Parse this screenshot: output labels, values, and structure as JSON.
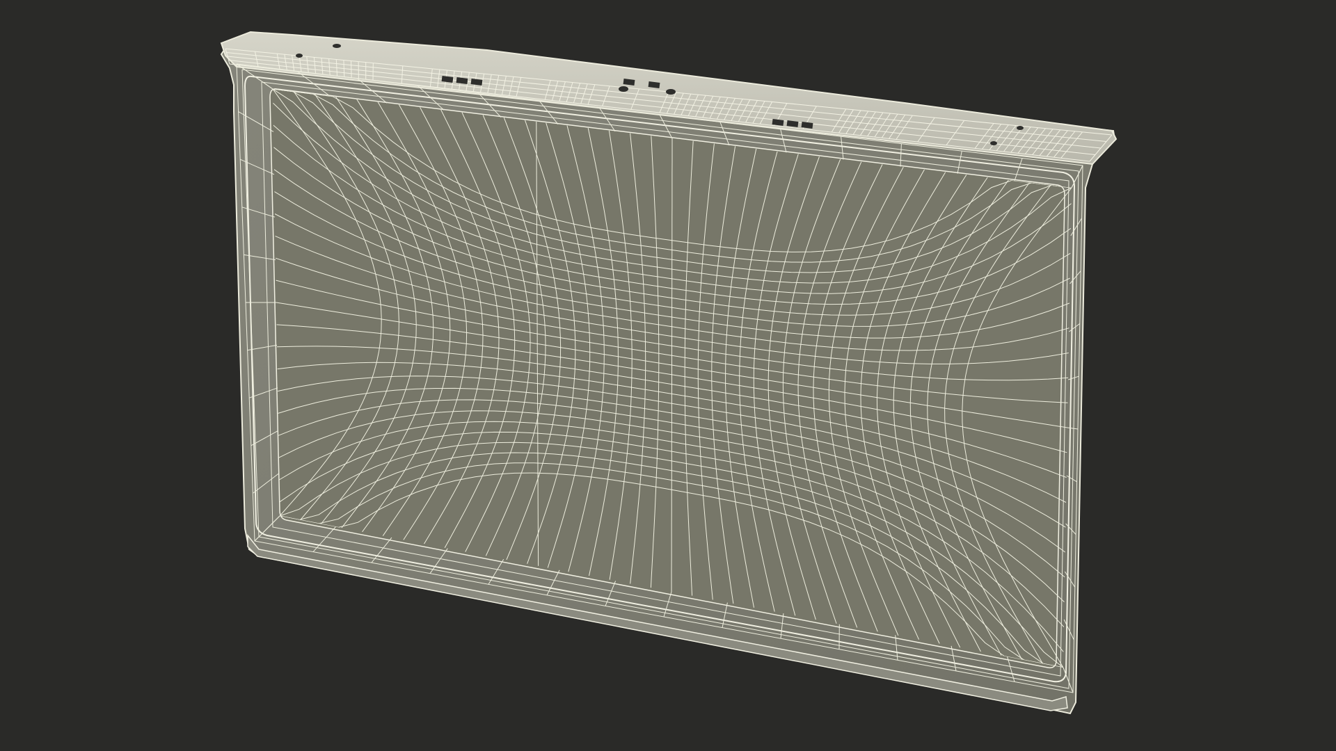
{
  "viewport": {
    "background_color": "#2a2a28"
  },
  "model": {
    "kind": "wireframe 3D render of a thin rectangular panel with a tray-like molded back",
    "surface_color": "#7d7d72",
    "surface_shade_color": "#6e6f64",
    "top_edge_color": "#c9c8bc",
    "wire_color": "#eeeede",
    "slot_color": "#2e2e2c"
  },
  "visible_text": []
}
